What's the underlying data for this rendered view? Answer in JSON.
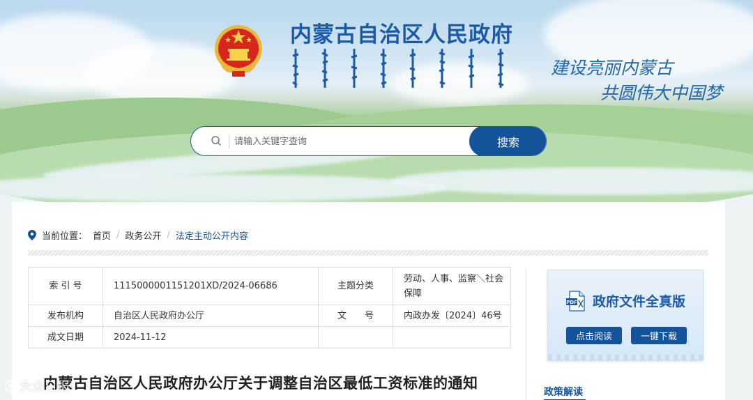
{
  "header": {
    "site_title": "内蒙古自治区人民政府",
    "slogan_line1": "建设亮丽内蒙古",
    "slogan_line2": "共圆伟大中国梦",
    "emblem": "national-emblem"
  },
  "search": {
    "placeholder": "请输入关键字查询",
    "button_label": "搜索",
    "icon": "search-icon"
  },
  "breadcrumb": {
    "label": "当前位置：",
    "items": [
      "首页",
      "政务公开",
      "法定主动公开内容"
    ]
  },
  "meta_table": {
    "index_label": "索 引 号",
    "index_value": "1115000001151201XD/2024-06686",
    "category_label": "主题分类",
    "category_value": "劳动、人事、监察＼社会保障",
    "issuer_label": "发布机构",
    "issuer_value": "自治区人民政府办公厅",
    "doc_no_label": "文　　号",
    "doc_no_value": "内政办发〔2024〕46号",
    "date_label": "成文日期",
    "date_value": "2024-11-12"
  },
  "doc_card": {
    "title": "政府文件全真版",
    "read_button": "点击阅读",
    "download_button": "一键下载",
    "icon": "pdf-icon"
  },
  "policy": {
    "title": "政策解读"
  },
  "article": {
    "title": "内蒙古自治区人民政府办公厅关于调整自治区最低工资标准的通知"
  },
  "watermark": {
    "text": "大众日报"
  },
  "colors": {
    "primary": "#13539a",
    "title_blue": "#1a5aa8"
  }
}
